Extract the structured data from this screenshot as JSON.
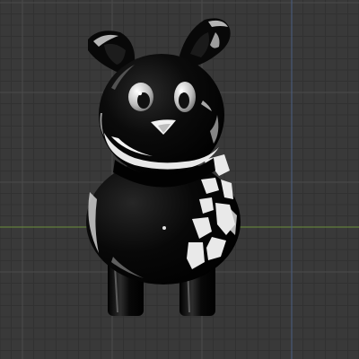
{
  "viewport": {
    "background_color": "#393939",
    "grid_minor_color": "#313131",
    "grid_major_color": "#4b4b4b",
    "axis_x_color": "#6a8f3a",
    "axis_y_color": "#4a5f82"
  },
  "model": {
    "object": "black-bear-figure",
    "body_color": "#050505",
    "highlight_color": "#e6e6e6",
    "nose_color": "#f2f2f2",
    "eye_white_color": "#d8d8d8"
  }
}
